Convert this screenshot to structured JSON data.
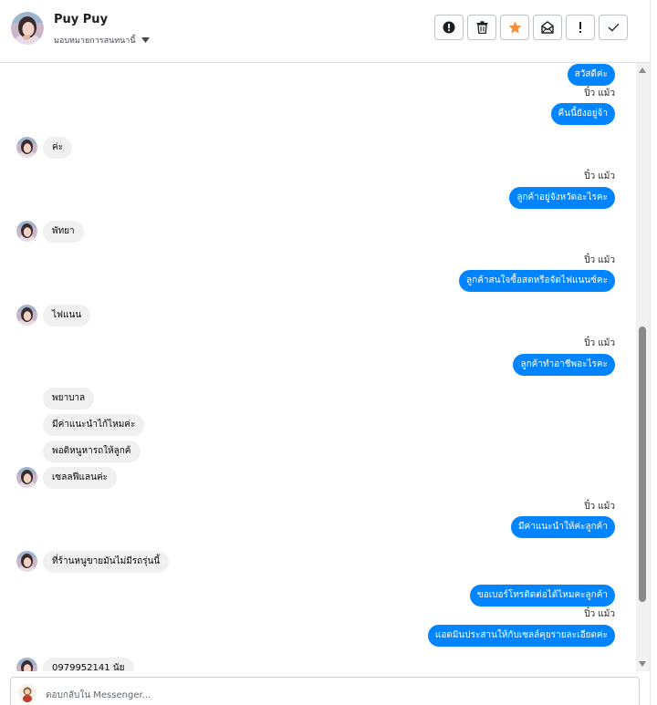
{
  "contact": {
    "name": "Puy Puy",
    "assign_label": "มอบหมายการสนทนานี้"
  },
  "toolbar": {
    "buttons": [
      {
        "name": "mark-spam",
        "icon": "alert-circle-icon"
      },
      {
        "name": "delete",
        "icon": "trash-icon"
      },
      {
        "name": "star",
        "icon": "star-icon"
      },
      {
        "name": "mark-unread",
        "icon": "envelope-icon"
      },
      {
        "name": "follow-up",
        "icon": "exclamation-icon"
      },
      {
        "name": "mark-done",
        "icon": "check-icon"
      }
    ]
  },
  "messages": [
    {
      "type": "out",
      "text": "สวัสดีค่ะ"
    },
    {
      "type": "sender",
      "text": "ปิ๋ว แม้ว"
    },
    {
      "type": "out",
      "text": "คืนนี้ยังอยู่จ้า"
    },
    {
      "type": "in",
      "text": "ค่ะ"
    },
    {
      "type": "sender",
      "text": "ปิ๋ว แม้ว"
    },
    {
      "type": "out",
      "text": "ลูกค้าอยู่จังหวัดอะไรคะ"
    },
    {
      "type": "in",
      "text": "พัทยา"
    },
    {
      "type": "sender",
      "text": "ปิ๋ว แม้ว"
    },
    {
      "type": "out",
      "text": "ลูกค้าสนใจซื้อสดหรือจัดไฟแนนซ์คะ"
    },
    {
      "type": "in",
      "text": "ไฟแนน"
    },
    {
      "type": "sender",
      "text": "ปิ๋ว แม้ว"
    },
    {
      "type": "out",
      "text": "ลูกค้าทำอาชีพอะไรคะ"
    },
    {
      "type": "in",
      "text": "พยาบาล"
    },
    {
      "type": "in",
      "text": "มีค่าแนะนำไก้ไหมค่ะ"
    },
    {
      "type": "in",
      "text": "พอดิหนูหารถให้ลูกค้"
    },
    {
      "type": "in",
      "text": "เซลลฟีแลนค่ะ"
    },
    {
      "type": "sender",
      "text": "ปิ๋ว แม้ว"
    },
    {
      "type": "out",
      "text": "มีค่าแนะนำให้ค่ะลูกค้า"
    },
    {
      "type": "in",
      "text": "ที่ร้านหนูขายมันไม่มีรถรุ่นนี้"
    },
    {
      "type": "out",
      "text": "ขอเบอร์โทรติดต่อได้ไหมคะลูกค้า"
    },
    {
      "type": "sender",
      "text": "ปิ๋ว แม้ว"
    },
    {
      "type": "out",
      "text": "แอดมินประสานให้กับเซลล์คุยรายละเอียดค่ะ"
    },
    {
      "type": "in",
      "text": "0979952141 นัย"
    }
  ],
  "composer": {
    "placeholder": "ตอบกลับใน Messenger..."
  },
  "colors": {
    "accent": "#0084ff",
    "star": "#f7923b",
    "incoming_bg": "#f0f0f0"
  }
}
